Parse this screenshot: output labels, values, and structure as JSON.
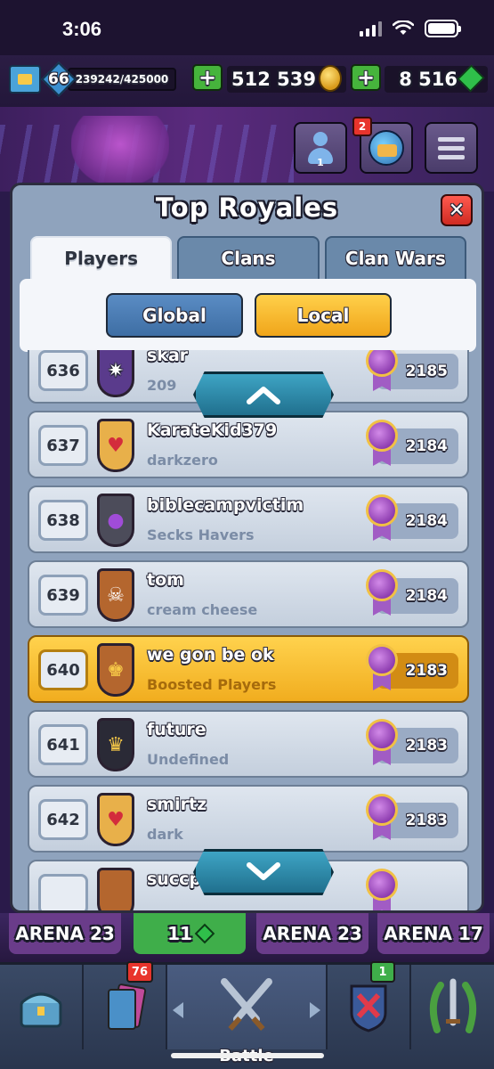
{
  "status_bar": {
    "time": "3:06"
  },
  "top_bar": {
    "level": "66",
    "xp": "239242/425000",
    "gold": "512 539",
    "gems": "8 516"
  },
  "header": {
    "friends_count": "1",
    "notification_count": "2"
  },
  "modal": {
    "title": "Top Royales",
    "close_label": "✕",
    "tabs": [
      {
        "label": "Players",
        "active": true
      },
      {
        "label": "Clans",
        "active": false
      },
      {
        "label": "Clan Wars",
        "active": false
      }
    ],
    "scope": {
      "global_label": "Global",
      "local_label": "Local",
      "selected": "Local"
    }
  },
  "leaderboard": [
    {
      "rank": "636",
      "name": "skar",
      "clan": "209",
      "trophies": "2185",
      "badge_color": "#5a3b8c",
      "icon": "✷",
      "highlighted": false
    },
    {
      "rank": "637",
      "name": "KarateKid379",
      "clan": "darkzero",
      "trophies": "2184",
      "badge_color": "#e8b04a",
      "icon": "♥",
      "highlighted": false
    },
    {
      "rank": "638",
      "name": "biblecampvictim",
      "clan": "Secks Havers",
      "trophies": "2184",
      "badge_color": "#4c4c5a",
      "icon": "●",
      "highlighted": false
    },
    {
      "rank": "639",
      "name": "tom",
      "clan": "cream cheese",
      "trophies": "2184",
      "badge_color": "#b4662e",
      "icon": "☠",
      "highlighted": false
    },
    {
      "rank": "640",
      "name": "we gon be ok",
      "clan": "Boosted Players",
      "trophies": "2183",
      "badge_color": "#b4662e",
      "icon": "♚",
      "highlighted": true
    },
    {
      "rank": "641",
      "name": "future",
      "clan": "Undefined",
      "trophies": "2183",
      "badge_color": "#2a2a36",
      "icon": "♛",
      "highlighted": false
    },
    {
      "rank": "642",
      "name": "smirtz",
      "clan": "dark",
      "trophies": "2183",
      "badge_color": "#e8b04a",
      "icon": "♥",
      "highlighted": false
    },
    {
      "rank": "",
      "name": "succpods",
      "clan": "",
      "trophies": "",
      "badge_color": "#b4662e",
      "icon": "",
      "highlighted": false
    }
  ],
  "arenas": [
    {
      "label": "ARENA 23"
    },
    {
      "label": "11"
    },
    {
      "label": "ARENA 23"
    },
    {
      "label": "ARENA 17"
    }
  ],
  "bottom_nav": {
    "battle_label": "Battle",
    "cards_badge": "76",
    "clan_badge": "1"
  },
  "colors": {
    "modal_bg": "#8fa3bd",
    "highlight": "#f1ad1f",
    "close": "#e0392f",
    "global_pill": "#3e6ea4",
    "local_pill": "#f0a51a"
  }
}
